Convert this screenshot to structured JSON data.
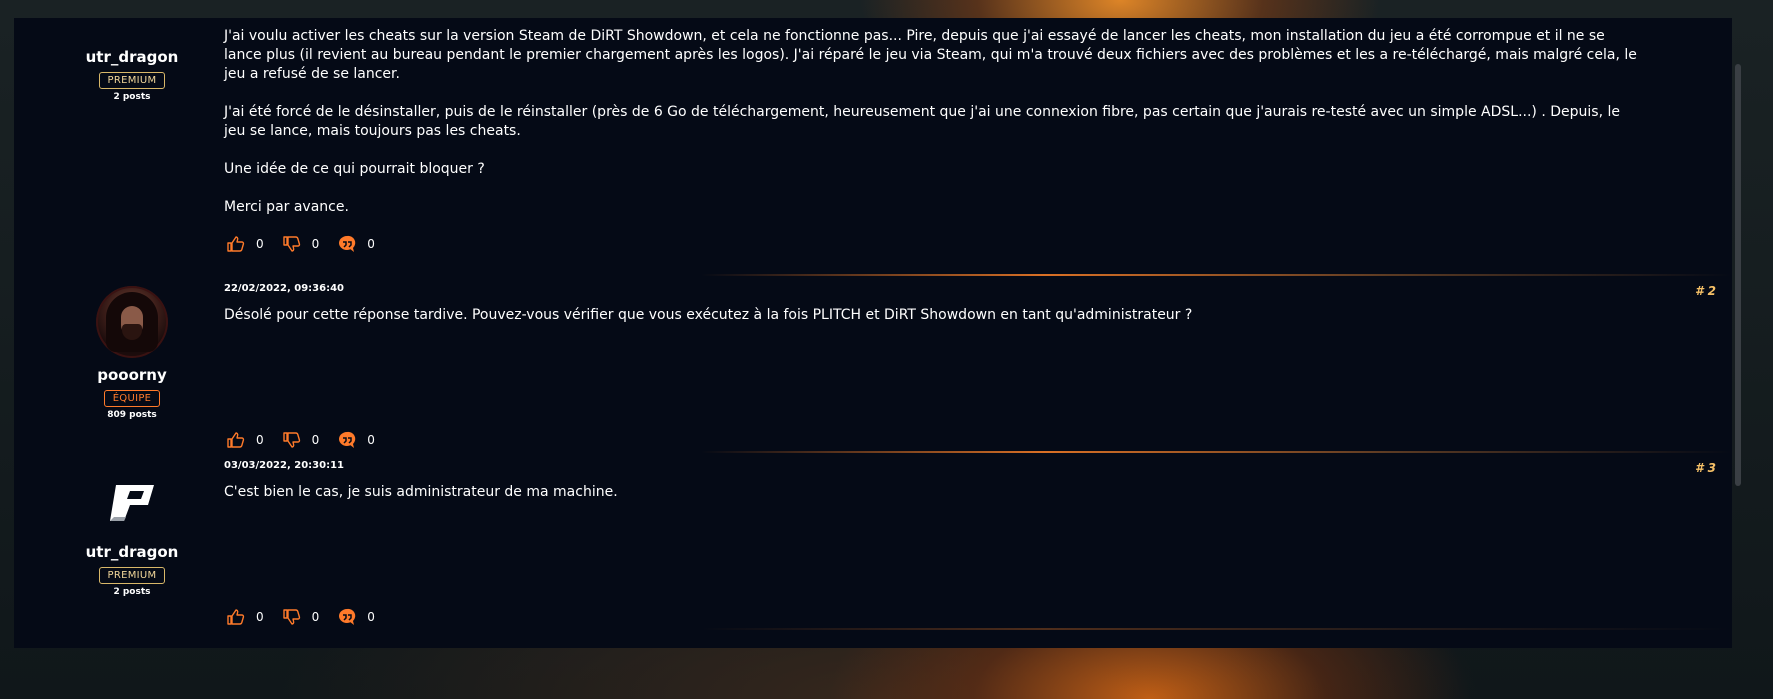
{
  "colors": {
    "panel_bg": "#050a16",
    "accent_orange": "#ff7a2a",
    "premium_gold": "#d9b869",
    "post_number": "#f5c067"
  },
  "posts": [
    {
      "author": {
        "name": "utr_dragon",
        "badge": "PREMIUM",
        "posts": "2 posts",
        "avatar": "plitch-logo"
      },
      "date": "",
      "number": "",
      "paragraphs": [
        "J'ai voulu activer les cheats sur la version Steam de DiRT Showdown, et cela ne fonctionne pas... Pire, depuis que j'ai essayé de lancer les cheats, mon installation du jeu a été corrompue et il ne se lance plus (il revient au bureau pendant le premier chargement après les logos). J'ai réparé le jeu via Steam, qui m'a trouvé deux fichiers avec des problèmes et les a re-téléchargé, mais malgré cela, le jeu a refusé de se lancer.",
        "J'ai été forcé de le désinstaller, puis de le réinstaller (près de 6 Go de téléchargement, heureusement que j'ai une connexion fibre, pas certain que j'aurais re-testé avec un simple ADSL...) . Depuis, le jeu se lance, mais toujours pas les cheats.",
        "Une idée de ce qui pourrait bloquer ?",
        "Merci par avance."
      ],
      "reactions": {
        "likes": "0",
        "dislikes": "0",
        "replies": "0"
      }
    },
    {
      "author": {
        "name": "pooorny",
        "badge": "ÉQUIPE",
        "posts": "809 posts",
        "avatar": "user-photo"
      },
      "date": "22/02/2022, 09:36:40",
      "number": "# 2",
      "paragraphs": [
        "Désolé pour cette réponse tardive. Pouvez-vous vérifier que vous exécutez à la fois PLITCH et DiRT Showdown en tant qu'administrateur ?"
      ],
      "reactions": {
        "likes": "0",
        "dislikes": "0",
        "replies": "0"
      }
    },
    {
      "author": {
        "name": "utr_dragon",
        "badge": "PREMIUM",
        "posts": "2 posts",
        "avatar": "plitch-logo"
      },
      "date": "03/03/2022, 20:30:11",
      "number": "# 3",
      "paragraphs": [
        "C'est bien le cas, je suis administrateur de ma machine."
      ],
      "reactions": {
        "likes": "0",
        "dislikes": "0",
        "replies": "0"
      }
    }
  ]
}
